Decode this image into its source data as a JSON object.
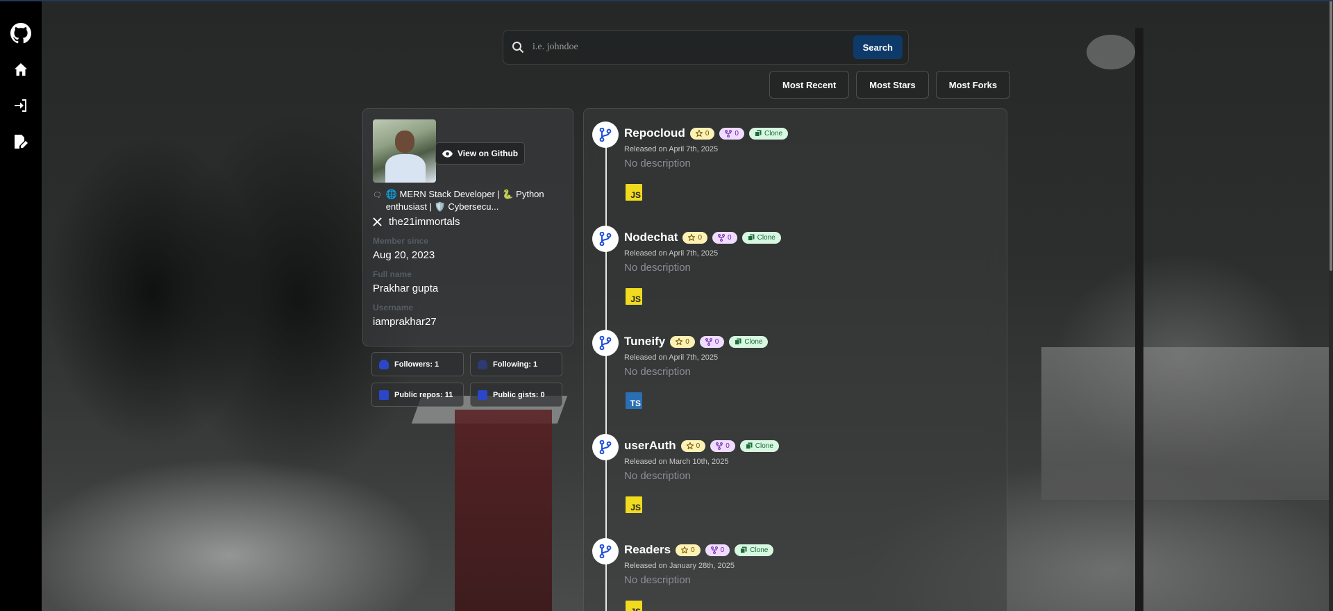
{
  "search": {
    "placeholder": "i.e. johndoe",
    "button_label": "Search"
  },
  "sort": {
    "buttons": [
      "Most Recent",
      "Most Stars",
      "Most Forks"
    ]
  },
  "profile": {
    "view_github_label": "View on Github",
    "bio": "🌐 MERN Stack Developer | 🐍 Python enthusiast | 🛡️ Cybersecu...",
    "twitter": "the21immortals",
    "member_since_label": "Member since",
    "member_since": "Aug 20, 2023",
    "full_name_label": "Full name",
    "full_name": "Prakhar gupta",
    "username_label": "Username",
    "username": "iamprakhar27"
  },
  "stats": {
    "followers": "Followers: 1",
    "following": "Following: 1",
    "public_repos": "Public repos: 11",
    "public_gists": "Public gists: 0"
  },
  "repos": [
    {
      "name": "Repocloud",
      "stars": "0",
      "forks": "0",
      "clone_label": "Clone",
      "released": "Released on April 7th, 2025",
      "description": "No description",
      "language": "JS"
    },
    {
      "name": "Nodechat",
      "stars": "0",
      "forks": "0",
      "clone_label": "Clone",
      "released": "Released on April 7th, 2025",
      "description": "No description",
      "language": "JS"
    },
    {
      "name": "Tuneify",
      "stars": "0",
      "forks": "0",
      "clone_label": "Clone",
      "released": "Released on April 7th, 2025",
      "description": "No description",
      "language": "TS"
    },
    {
      "name": "userAuth",
      "stars": "0",
      "forks": "0",
      "clone_label": "Clone",
      "released": "Released on March 10th, 2025",
      "description": "No description",
      "language": "JS"
    },
    {
      "name": "Readers",
      "stars": "0",
      "forks": "0",
      "clone_label": "Clone",
      "released": "Released on January 28th, 2025",
      "description": "No description",
      "language": "JS"
    }
  ],
  "sidebar": {
    "icons": [
      "github-icon",
      "home-icon",
      "login-icon",
      "signup-icon"
    ]
  },
  "colors": {
    "search_button": "#0e3a6a",
    "stat_icon": "#2b46c7",
    "js_badge": "#f0db1e",
    "ts_badge": "#2b6fb3"
  }
}
